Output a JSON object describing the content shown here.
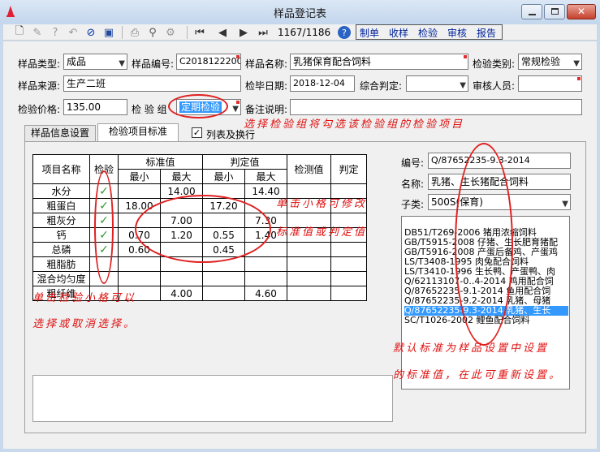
{
  "window": {
    "title": "样品登记表"
  },
  "toolbar": {
    "record_counter": "1167/1186",
    "menu": [
      "制单",
      "收样",
      "检验",
      "审核",
      "报告"
    ]
  },
  "form": {
    "sample_type": {
      "label": "样品类型:",
      "value": "成品"
    },
    "sample_no": {
      "label": "样品编号:",
      "value": "C20181222001"
    },
    "sample_name": {
      "label": "样品名称:",
      "value": "乳猪保育配合饲料"
    },
    "inspect_category": {
      "label": "检验类别:",
      "value": "常规检验"
    },
    "sample_source": {
      "label": "样品来源:",
      "value": "生产二班"
    },
    "inspect_date": {
      "label": "检毕日期:",
      "value": "2018-12-04"
    },
    "overall_judge": {
      "label": "综合判定:",
      "value": ""
    },
    "reviewer": {
      "label": "审核人员:",
      "value": ""
    },
    "inspect_price": {
      "label": "检验价格:",
      "value": "135.00"
    },
    "inspect_group": {
      "label": "检 验 组",
      "value": "定期检验"
    },
    "remark": {
      "label": "备注说明:",
      "value": ""
    }
  },
  "tabs": [
    "样品信息设置",
    "检验项目标准"
  ],
  "wrap_checkbox": {
    "label": "列表及换行",
    "checked": true
  },
  "grid": {
    "headers": {
      "item": "项目名称",
      "check": "检验",
      "std": "标准值",
      "judge": "判定值",
      "result": "检测值",
      "verdict": "判定",
      "min": "最小",
      "max": "最大"
    },
    "rows": [
      {
        "name": "水分",
        "check": "✓",
        "std_min": "",
        "std_max": "14.00",
        "j_min": "",
        "j_max": "14.40"
      },
      {
        "name": "粗蛋白",
        "check": "✓",
        "std_min": "18.00",
        "std_max": "",
        "j_min": "17.20",
        "j_max": ""
      },
      {
        "name": "粗灰分",
        "check": "✓",
        "std_min": "",
        "std_max": "7.00",
        "j_min": "",
        "j_max": "7.30"
      },
      {
        "name": "钙",
        "check": "✓",
        "std_min": "0.70",
        "std_max": "1.20",
        "j_min": "0.55",
        "j_max": "1.40"
      },
      {
        "name": "总磷",
        "check": "✓",
        "std_min": "0.60",
        "std_max": "",
        "j_min": "0.45",
        "j_max": ""
      },
      {
        "name": "粗脂肪",
        "check": "",
        "std_min": "",
        "std_max": "",
        "j_min": "",
        "j_max": ""
      },
      {
        "name": "混合均匀度",
        "check": "",
        "std_min": "",
        "std_max": "",
        "j_min": "",
        "j_max": ""
      },
      {
        "name": "粗纤维",
        "check": "",
        "std_min": "",
        "std_max": "4.00",
        "j_min": "",
        "j_max": "4.60"
      }
    ]
  },
  "standard": {
    "code_label": "编号:",
    "code_value": "Q/87652235-9.3-2014",
    "name_label": "名称:",
    "name_value": "乳猪、生长猪配合饲料",
    "subclass_label": "子类:",
    "subclass_value": "500S(保育)",
    "list": [
      "DB51/T269-2006 猪用浓缩饲料",
      "GB/T5915-2008  仔猪、生长肥育猪配",
      "GB/T5916-2008  产蛋后备鸡、产蛋鸡",
      "LS/T3408-1995  肉兔配合饲料",
      "LS/T3410-1996  生长鸭、产蛋鸭、肉",
      "Q/62113107-0..4-2014  鸡用配合饲",
      "Q/87652235-9.1-2014  鱼用配合饲",
      "Q/87652235-9.2-2014  乳猪、母猪",
      "Q/87652235-9.3-2014  乳猪、生长",
      "SC/T1026-2002  鲤鱼配合饲料"
    ],
    "selected_index": 8
  },
  "annotations": {
    "group_hint": "选择检验组将勾选该检验组的检验项目",
    "cell_hint_1": "单击小格可修改",
    "cell_hint_2": "标准值或判定值",
    "check_hint_1": "单击检验小格可以",
    "check_hint_2": "选择或取消选择。",
    "default_hint_1": "默认标准为样品设置中设置",
    "default_hint_2": "的标准值，在此可重新设置。"
  },
  "colors": {
    "annotation": "#e01010",
    "selection": "#3399ff",
    "check": "#2e9a2e"
  }
}
